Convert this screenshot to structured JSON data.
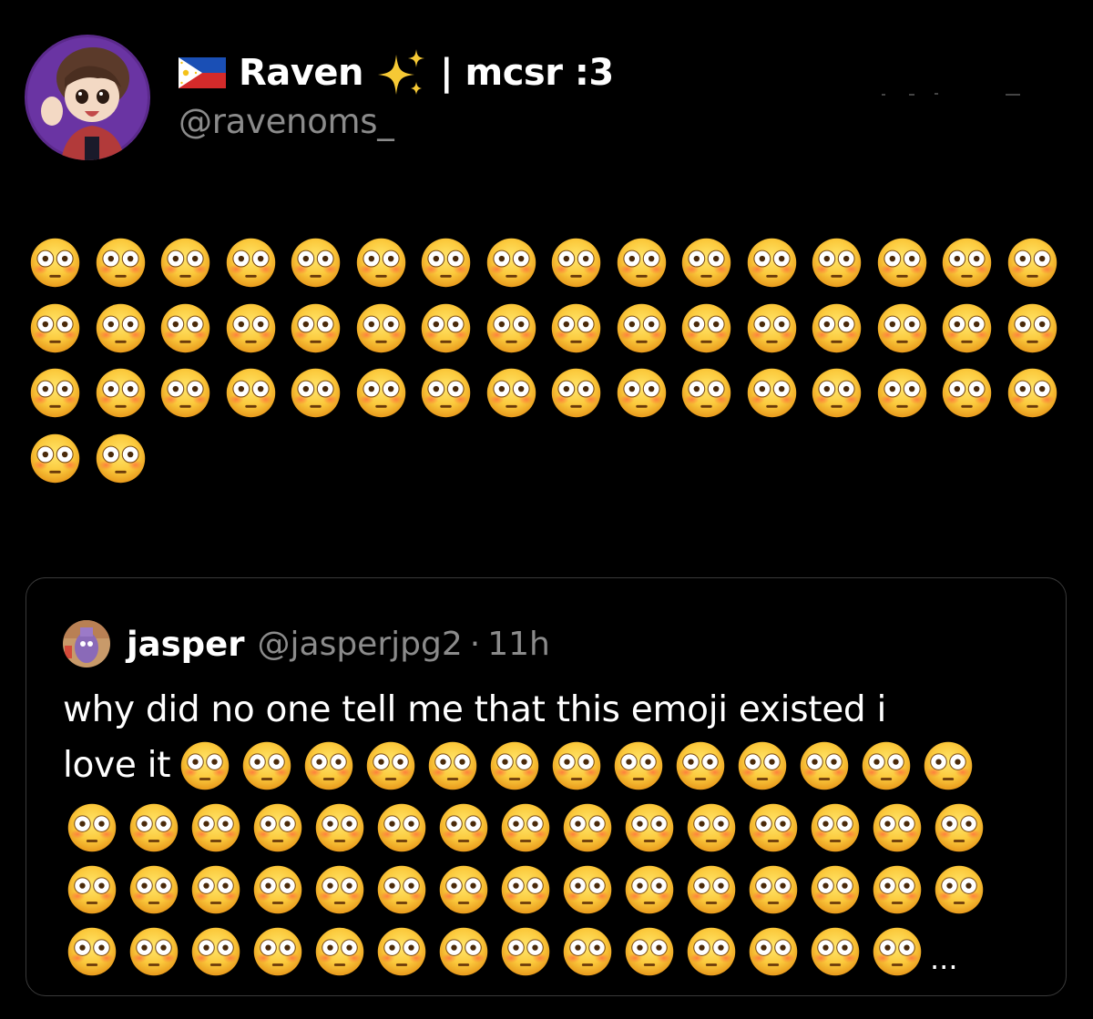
{
  "author": {
    "flag_icon": "philippines-flag-icon",
    "display_name": "Raven",
    "sparkle_icon": "sparkles-icon",
    "name_suffix": "| mcsr :3",
    "handle": "@ravenoms_"
  },
  "tweet": {
    "emoji": "flushed-face",
    "emoji_rows": [
      16,
      16,
      16,
      2
    ]
  },
  "quoted": {
    "name": "jasper",
    "handle": "@jasperjpg2",
    "separator": "·",
    "time": "11h",
    "text_line1": "why did no one tell me that this emoji existed i",
    "text_line2": "love it",
    "emoji": "flushed-face",
    "emoji_rows": [
      13,
      15,
      15,
      14
    ],
    "truncation": "..."
  },
  "colors": {
    "background": "#000000",
    "text": "#ffffff",
    "secondary_text": "#8b8b8b",
    "card_border": "#3a3a3a"
  }
}
